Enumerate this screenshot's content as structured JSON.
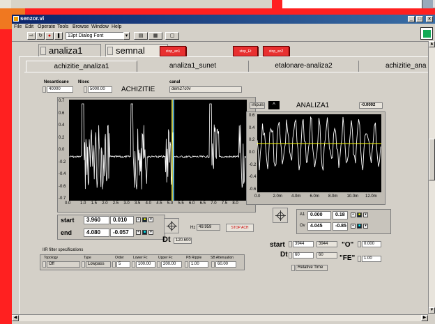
{
  "window": {
    "title": "senzor.vi",
    "menus": [
      "File",
      "Edit",
      "Operate",
      "Tools",
      "Browse",
      "Window",
      "Help"
    ],
    "font_selector": "13pt Dialog Font",
    "controls": [
      "_",
      "□",
      "×"
    ]
  },
  "outer_tabs": {
    "items": [
      "analiza1",
      "semnal"
    ],
    "selected": "semnal",
    "stop_buttons": [
      "stop_an1",
      "stop_Et",
      "stop_an2"
    ]
  },
  "inner_tabs": [
    "achizitie_analiza1",
    "analiza1_sunet",
    "etalonare-analiza2",
    "achizitie_ana"
  ],
  "acquisition": {
    "nesantioane_label": "Nesantioane",
    "nesantioane_value": "40000",
    "nsec_label": "N/sec",
    "nsec_value": "5000.00",
    "title": "ACHIZITIE",
    "canal_label": "canal",
    "canal_value": "dem27c0v",
    "y_ticks": [
      "0.7",
      "0.6",
      "0.4",
      "0.2",
      "0.0",
      "-0.2",
      "-0.4",
      "-0.6",
      "-0.7"
    ],
    "x_ticks": [
      "0.0",
      "1.0",
      "1.5",
      "2.0",
      "2.5",
      "3.0",
      "3.5",
      "4.0",
      "4.5",
      "5.0",
      "5.5",
      "6.0",
      "6.5",
      "7.0",
      "7.5",
      "8.0"
    ],
    "cursors": [
      {
        "name": "start",
        "x": "3.960",
        "y": "0.010"
      },
      {
        "name": "end",
        "x": "4.080",
        "y": "-0.057"
      }
    ],
    "hz_label": "Hz",
    "hz_value": "49.959",
    "stop_label": "STOP ACH",
    "dt_label": "Dt",
    "dt_value": "120.600"
  },
  "analysis": {
    "impuls_label": "impuls",
    "title": "ANALIZA1",
    "value": "-0.0002",
    "y_ticks": [
      "0.6",
      "0.4",
      "0.2",
      "0.0",
      "-0.2",
      "-0.4",
      "-0.6"
    ],
    "x_ticks": [
      "0.0",
      "2.0m",
      "4.0m",
      "6.0m",
      "8.0m",
      "10.0m",
      "12.0m"
    ],
    "cursors": [
      {
        "name": "A1",
        "x": "0.000",
        "y": "0.18"
      },
      {
        "name": "Ov",
        "x": "4.045",
        "y": "-0.85"
      }
    ],
    "start_label": "start",
    "start_values": [
      "3944",
      "3944"
    ],
    "dt_label": "Dt",
    "dt_values": [
      "60",
      "60"
    ],
    "o_label": "\"O\"",
    "o_value": "0.000",
    "fe_label": "\"FE\"",
    "fe_value": "1.00",
    "relative_time": "Relative Time"
  },
  "iir": {
    "title": "IIR filter specifications",
    "headers": [
      "Topology",
      "Type",
      "Order",
      "Lower Fc",
      "Upper Fc",
      "PB Ripple",
      "SB Attenuation"
    ],
    "values": [
      "Off",
      "Lowpass",
      "5",
      "100.00",
      "200.00",
      "1.00",
      "60.00"
    ]
  },
  "colors": {
    "background": "#ff2020",
    "titlebar": "#0a246a",
    "plot_bg": "#000000",
    "trace": "#ffffff",
    "cursor_line": "#ffff00",
    "stop_button": "#e83030"
  }
}
